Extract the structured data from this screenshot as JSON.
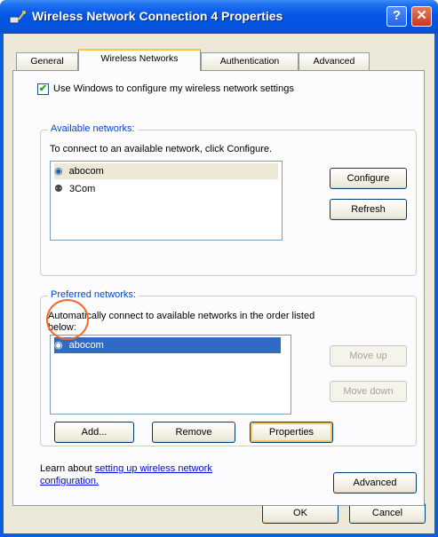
{
  "window": {
    "title": "Wireless Network Connection 4 Properties",
    "help_symbol": "?",
    "close_symbol": "✕"
  },
  "tabs": [
    {
      "label": "General"
    },
    {
      "label": "Wireless Networks"
    },
    {
      "label": "Authentication"
    },
    {
      "label": "Advanced"
    }
  ],
  "use_windows_checkbox": {
    "checked": true,
    "label": "Use Windows to configure my wireless network settings"
  },
  "available": {
    "group_title": "Available networks:",
    "description": "To connect to an available network, click Configure.",
    "networks": [
      {
        "name": "abocom",
        "icon": "wireless-network-icon",
        "selected": true
      },
      {
        "name": "3Com",
        "icon": "wireless-antenna-icon",
        "selected": false
      }
    ],
    "configure_label": "Configure",
    "refresh_label": "Refresh"
  },
  "preferred": {
    "group_title": "Preferred networks:",
    "description_line1": "Automatically connect to available networks in the order listed",
    "description_line2": "below:",
    "networks": [
      {
        "name": "abocom",
        "icon": "wireless-network-icon",
        "selected": true
      }
    ],
    "move_up_label": "Move up",
    "move_down_label": "Move down",
    "add_label": "Add...",
    "remove_label": "Remove",
    "properties_label": "Properties"
  },
  "learn": {
    "prefix": "Learn about",
    "link_line1": "setting up wireless network",
    "link_line2": "configuration."
  },
  "advanced_button_label": "Advanced",
  "ok_label": "OK",
  "cancel_label": "Cancel",
  "colors": {
    "titlebar": "#0555e5",
    "dialog_face": "#ece9d8",
    "group_title": "#0046d5",
    "selection": "#316ac5",
    "annotation_circle": "#f46a20"
  }
}
